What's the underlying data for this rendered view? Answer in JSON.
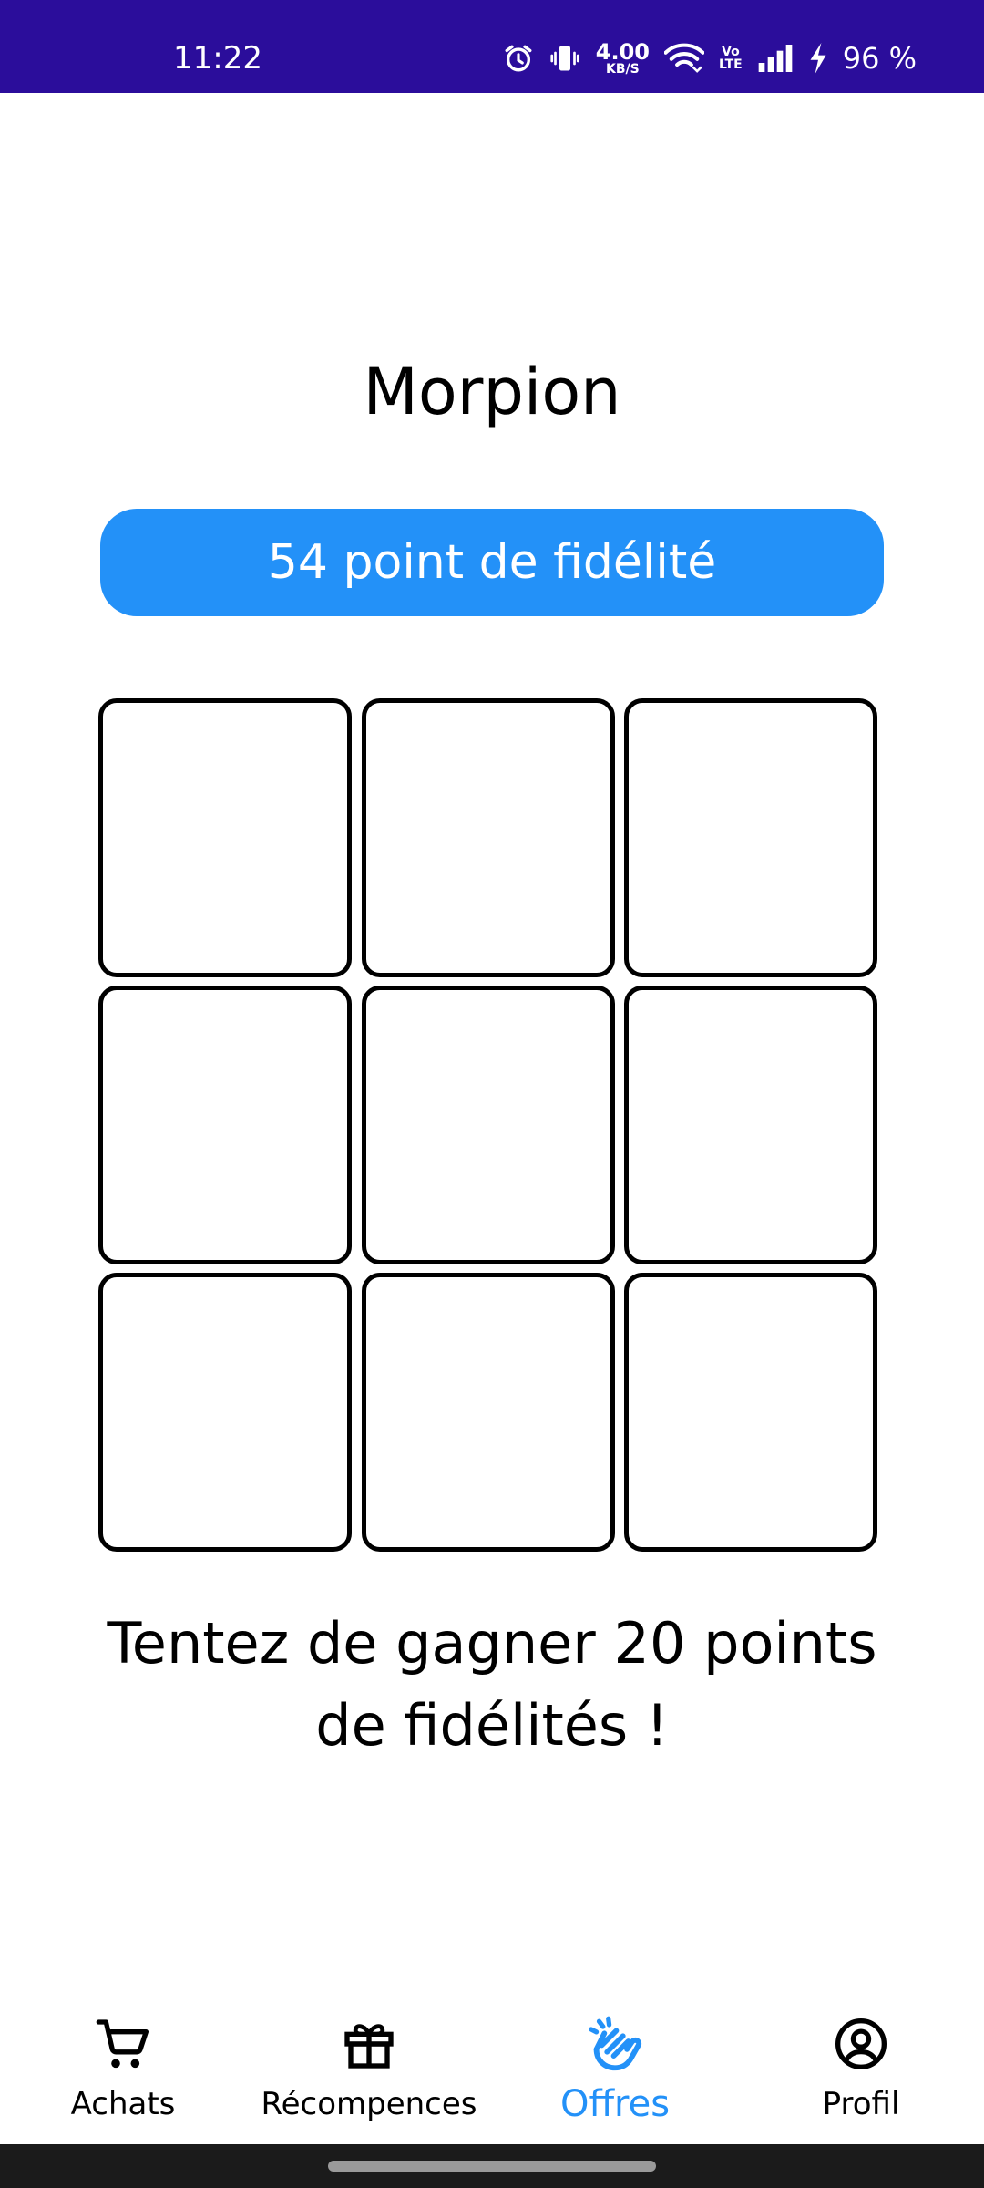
{
  "status_bar": {
    "time": "11:22",
    "net_speed_value": "4.00",
    "net_speed_unit": "KB/S",
    "volte_top": "Vo",
    "volte_bottom": "LTE",
    "battery": "96 %",
    "background_color": "#2b0d9b"
  },
  "game": {
    "title": "Morpion",
    "points_label": "54 point de fidélité",
    "board": [
      [
        "",
        "",
        ""
      ],
      [
        "",
        "",
        ""
      ],
      [
        "",
        "",
        ""
      ]
    ],
    "promo_text": "Tentez de gagner 20 points de fidélités !"
  },
  "bottom_nav": {
    "items": [
      {
        "label": "Achats",
        "icon": "cart-icon",
        "active": false
      },
      {
        "label": "Récompences",
        "icon": "gift-icon",
        "active": false
      },
      {
        "label": "Offres",
        "icon": "offers-hand-icon",
        "active": true
      },
      {
        "label": "Profil",
        "icon": "profile-icon",
        "active": false
      }
    ]
  },
  "colors": {
    "accent": "#2391f8",
    "text": "#000000",
    "gesture_bar": "#1b1b1b"
  }
}
